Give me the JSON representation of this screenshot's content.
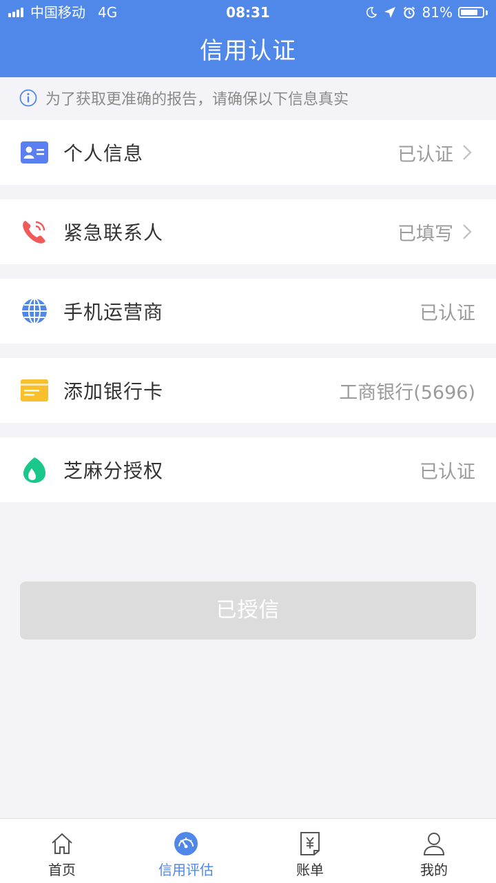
{
  "status_bar": {
    "carrier": "中国移动",
    "network": "4G",
    "time": "08:31",
    "battery_percent": "81%",
    "battery_level": 0.81
  },
  "header": {
    "title": "信用认证"
  },
  "notice": {
    "text": "为了获取更准确的报告，请确保以下信息真实"
  },
  "rows": [
    {
      "label": "个人信息",
      "value": "已认证",
      "icon": "id-card-icon"
    },
    {
      "label": "紧急联系人",
      "value": "已填写",
      "icon": "phone-icon"
    },
    {
      "label": "手机运营商",
      "value": "已认证",
      "icon": "globe-icon"
    },
    {
      "label": "添加银行卡",
      "value": "工商银行(5696)",
      "icon": "bank-card-icon"
    },
    {
      "label": "芝麻分授权",
      "value": "已认证",
      "icon": "sesame-icon"
    }
  ],
  "button": {
    "label": "已授信"
  },
  "tabs": [
    {
      "label": "首页",
      "icon": "home-icon"
    },
    {
      "label": "信用评估",
      "icon": "gauge-icon"
    },
    {
      "label": "账单",
      "icon": "bill-icon"
    },
    {
      "label": "我的",
      "icon": "user-icon"
    }
  ],
  "colors": {
    "primary": "#4f88e8",
    "phone": "#f25a5a",
    "bank_card": "#f9bf2c",
    "sesame": "#19c78a",
    "id_card": "#5a7ff0"
  }
}
